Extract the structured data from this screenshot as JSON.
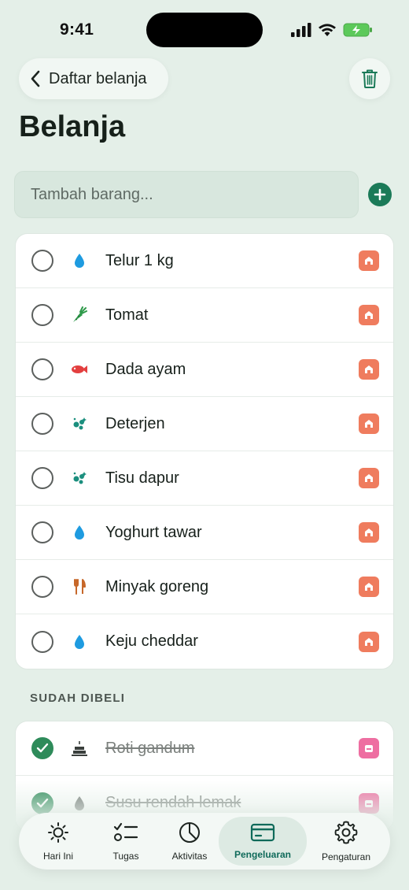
{
  "status_bar": {
    "time": "9:41"
  },
  "nav": {
    "back_label": "Daftar belanja"
  },
  "page_title": "Belanja",
  "add": {
    "placeholder": "Tambah barang..."
  },
  "active_items": [
    {
      "label": "Telur 1 kg",
      "icon": "droplet-icon"
    },
    {
      "label": "Tomat",
      "icon": "carrot-icon"
    },
    {
      "label": "Dada ayam",
      "icon": "fish-icon"
    },
    {
      "label": "Deterjen",
      "icon": "bubbles-icon"
    },
    {
      "label": "Tisu dapur",
      "icon": "bubbles-icon"
    },
    {
      "label": "Yoghurt tawar",
      "icon": "droplet-icon"
    },
    {
      "label": "Minyak goreng",
      "icon": "fork-knife-icon"
    },
    {
      "label": "Keju cheddar",
      "icon": "droplet-icon"
    }
  ],
  "done_section": {
    "title": "SUDAH DIBELI",
    "items": [
      {
        "label": "Roti gandum",
        "icon": "cake-icon"
      },
      {
        "label": "Susu rendah lemak",
        "icon": "droplet-icon"
      }
    ]
  },
  "tabs": [
    {
      "label": "Hari Ini",
      "icon": "sun-icon"
    },
    {
      "label": "Tugas",
      "icon": "checklist-icon"
    },
    {
      "label": "Aktivitas",
      "icon": "pie-chart-icon"
    },
    {
      "label": "Pengeluaran",
      "icon": "card-icon",
      "active": true
    },
    {
      "label": "Pengaturan",
      "icon": "gear-icon"
    }
  ],
  "colors": {
    "accent": "#1b7a58",
    "background": "#e4efe8",
    "store_badge": "#ef7c5e",
    "store_badge_alt": "#ee6ea1",
    "checked": "#2e8b5a"
  }
}
